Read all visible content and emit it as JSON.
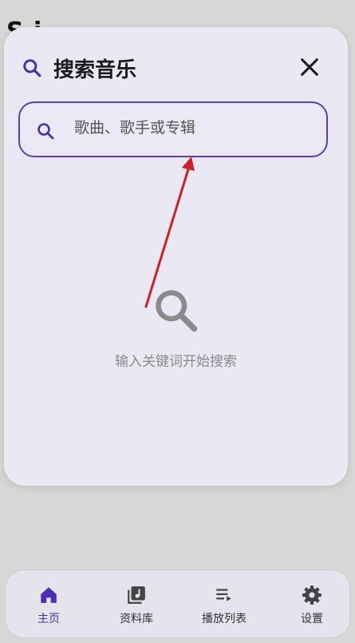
{
  "background": {
    "title_fragment": "S   i"
  },
  "dialog": {
    "title": "搜索音乐",
    "search": {
      "placeholder": "歌曲、歌手或专辑"
    },
    "empty_state": {
      "text": "输入关键词开始搜索"
    }
  },
  "nav": {
    "items": [
      {
        "label": "主页",
        "icon": "home-icon",
        "active": true
      },
      {
        "label": "资料库",
        "icon": "library-icon",
        "active": false
      },
      {
        "label": "播放列表",
        "icon": "playlist-icon",
        "active": false
      },
      {
        "label": "设置",
        "icon": "gear-icon",
        "active": false
      }
    ]
  },
  "colors": {
    "accent": "#5b3fc4",
    "arrow": "#d21f26",
    "dialog_bg": "#eae8f3"
  }
}
